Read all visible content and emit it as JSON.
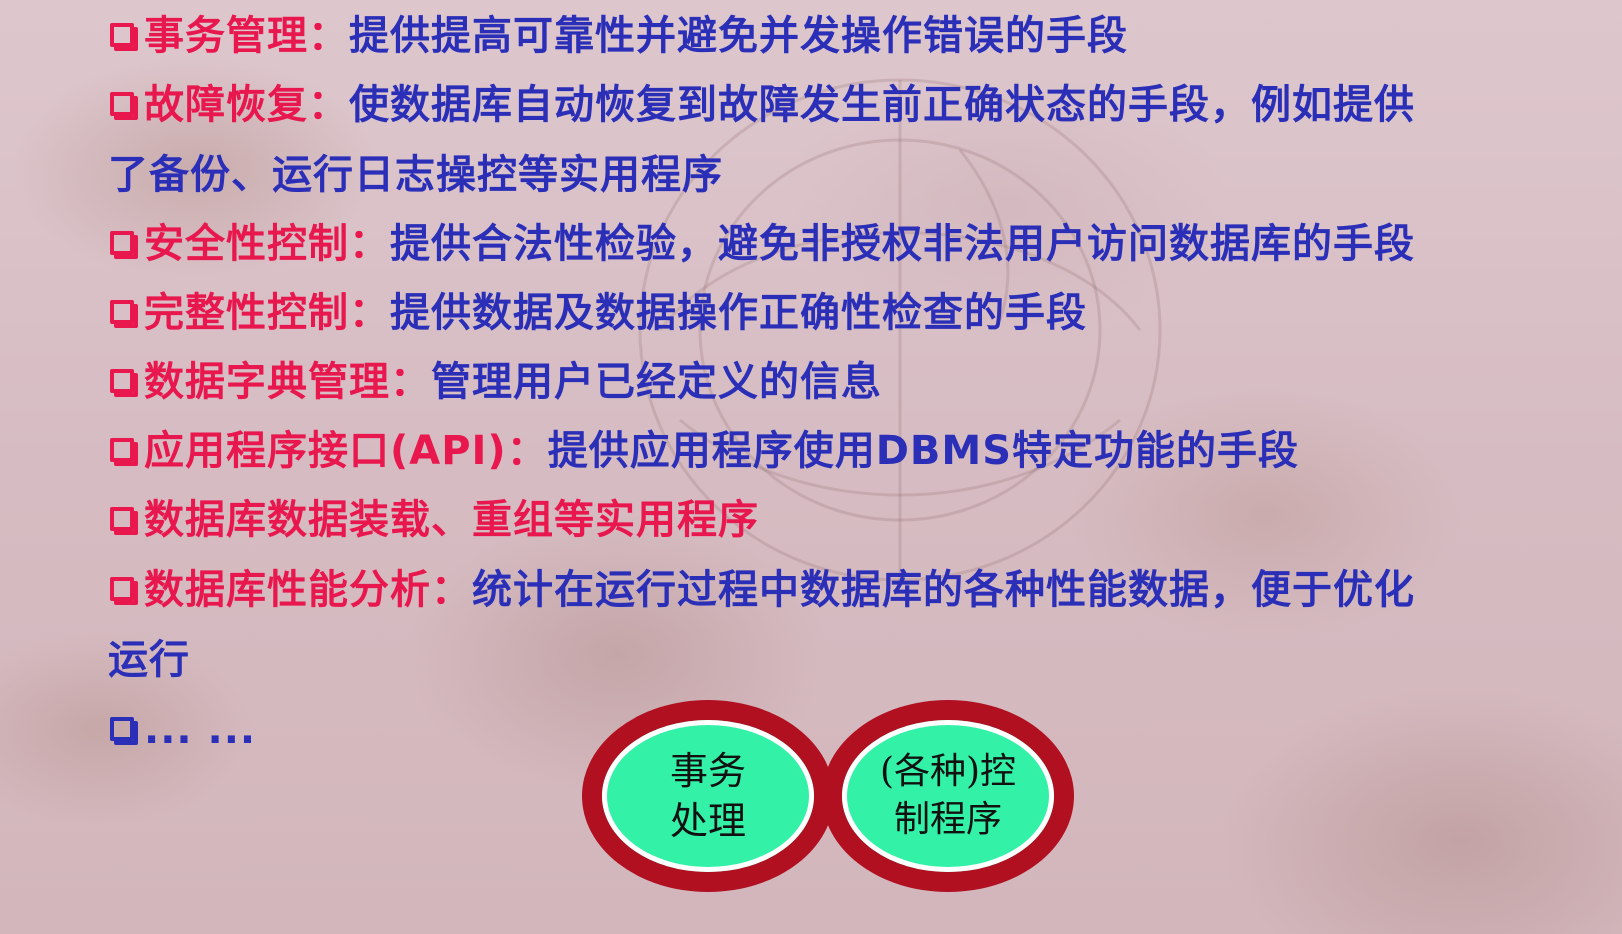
{
  "items": [
    {
      "term": "事务管理",
      "sep": "：",
      "desc": "提供提高可靠性并避免并发操作错误的手段"
    },
    {
      "term": "故障恢复",
      "sep": "：",
      "desc": "使数据库自动恢复到故障发生前正确状态的手段，例如提供",
      "desc_cont": "了备份、运行日志操控等实用程序"
    },
    {
      "term": "安全性控制",
      "sep": "：",
      "desc": "提供合法性检验，避免非授权非法用户访问数据库的手段"
    },
    {
      "term": "完整性控制",
      "sep": "：",
      "desc": "提供数据及数据操作正确性检查的手段"
    },
    {
      "term": "数据字典管理",
      "sep": "：",
      "desc": "管理用户已经定义的信息"
    },
    {
      "term": "应用程序接口(API)",
      "sep": "：",
      "desc": "提供应用程序使用DBMS特定功能的手段"
    },
    {
      "term": "数据库数据装载、重组等实用程序",
      "sep": "",
      "desc": ""
    },
    {
      "term": "数据库性能分析",
      "sep": "：",
      "desc": "统计在运行过程中数据库的各种性能数据，便于优化",
      "desc_cont": "运行"
    },
    {
      "term": "",
      "sep": "",
      "desc": "... ..."
    }
  ],
  "circles": [
    {
      "text": "事务\n处理"
    },
    {
      "text": "(各种)控\n制程序"
    }
  ],
  "colors": {
    "term": "#e8174e",
    "desc": "#2b2fb8",
    "ring": "#b01020",
    "circle_fill": "#33f2a8"
  }
}
